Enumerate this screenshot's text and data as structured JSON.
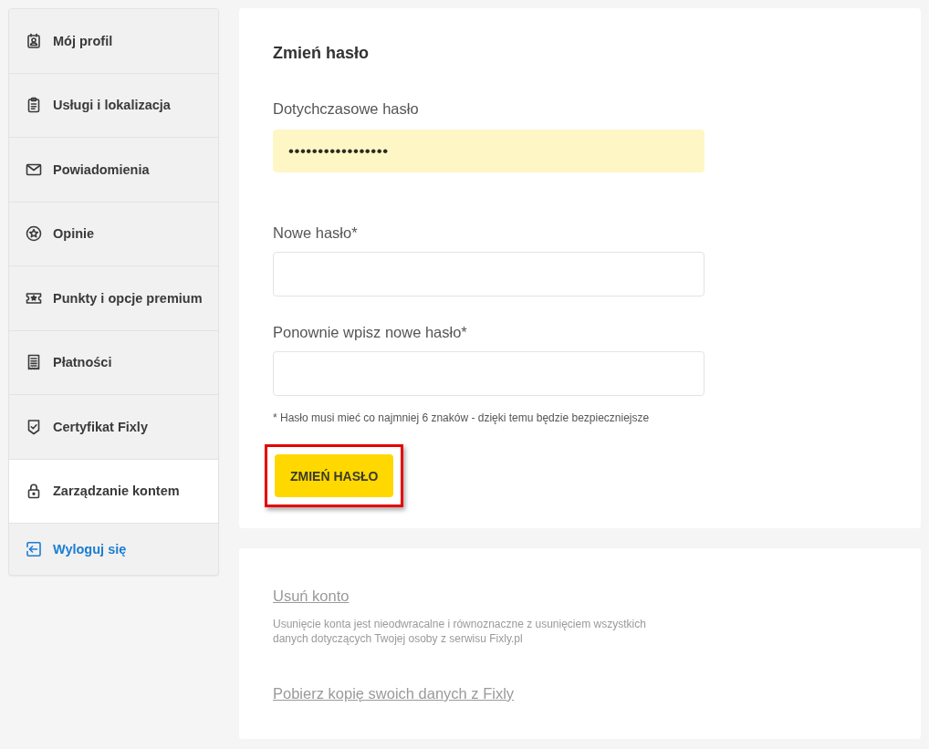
{
  "sidebar": {
    "items": [
      {
        "label": "Mój profil",
        "selected": false
      },
      {
        "label": "Usługi i lokalizacja",
        "selected": false
      },
      {
        "label": "Powiadomienia",
        "selected": false
      },
      {
        "label": "Opinie",
        "selected": false
      },
      {
        "label": "Punkty i opcje premium",
        "selected": false
      },
      {
        "label": "Płatności",
        "selected": false
      },
      {
        "label": "Certyfikat Fixly",
        "selected": false
      },
      {
        "label": "Zarządzanie kontem",
        "selected": true
      }
    ],
    "logout": {
      "label": "Wyloguj się"
    }
  },
  "change_password": {
    "title": "Zmień hasło",
    "fields": [
      {
        "label": "Dotychczasowe hasło",
        "value": "•••••••••••••••••",
        "autofilled": true
      },
      {
        "label": "Nowe hasło*",
        "autofilled": false
      },
      {
        "label": "Ponownie wpisz nowe hasło*",
        "autofilled": false
      }
    ],
    "hint": "* Hasło musi mieć co najmniej 6 znaków - dzięki temu będzie bezpieczniejsze",
    "button": {
      "label": "ZMIEŃ HASŁO",
      "highlighted": true
    }
  },
  "account": {
    "delete_link": "Usuń konto",
    "delete_note": "Usunięcie konta jest nieodwracalne i równoznaczne z usunięciem wszystkich danych dotyczących Twojej osoby z serwisu Fixly.pl",
    "download_link": "Pobierz kopię swoich danych z Fixly"
  }
}
